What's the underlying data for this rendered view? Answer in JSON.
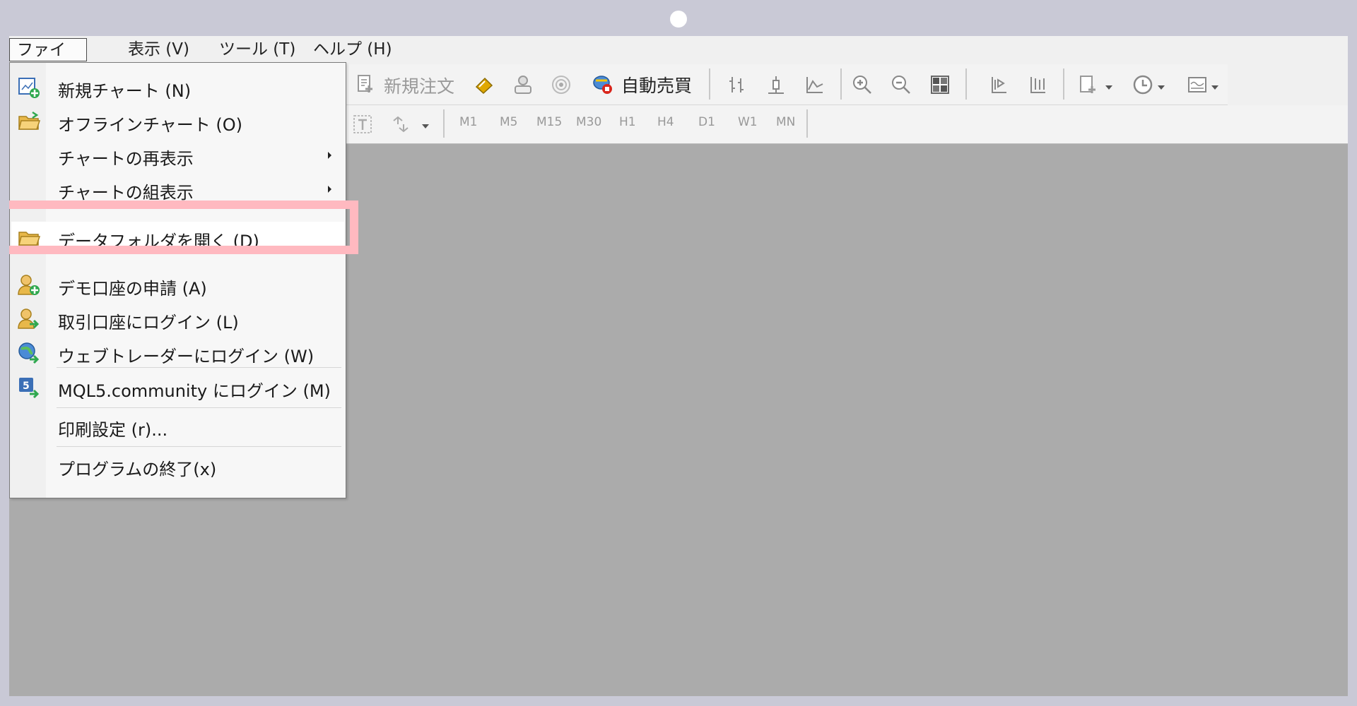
{
  "menubar": {
    "items": [
      {
        "label": "ファイル (F)"
      },
      {
        "label": "表示 (V)"
      },
      {
        "label": "ツール (T)"
      },
      {
        "label": "ヘルプ (H)"
      }
    ]
  },
  "toolbar": {
    "new_order_label": "新規注文",
    "auto_trade_label": "自動売買",
    "timeframes": [
      "M1",
      "M5",
      "M15",
      "M30",
      "H1",
      "H4",
      "D1",
      "W1",
      "MN"
    ]
  },
  "file_menu": {
    "items": [
      {
        "label": "新規チャート (N)",
        "icon": "new-chart-icon"
      },
      {
        "label": "オフラインチャート (O)",
        "icon": "open-folder-icon"
      },
      {
        "label": "チャートの再表示",
        "submenu": true
      },
      {
        "label": "チャートの組表示",
        "submenu": true
      },
      {
        "label": "データフォルダを開く (D)",
        "icon": "folder-icon",
        "highlighted": true
      },
      {
        "label": "デモ口座の申請 (A)",
        "icon": "add-user-icon"
      },
      {
        "label": "取引口座にログイン (L)",
        "icon": "login-user-icon"
      },
      {
        "label": "ウェブトレーダーにログイン (W)",
        "icon": "globe-icon"
      },
      {
        "label": "MQL5.community にログイン (M)",
        "icon": "mql5-icon"
      },
      {
        "label": "印刷設定 (r)..."
      },
      {
        "label": "プログラムの終了(x)"
      }
    ]
  },
  "colors": {
    "highlight": "#ffb9c0",
    "chart_bg": "#ababab",
    "frame_bg": "#c9c9d6"
  }
}
